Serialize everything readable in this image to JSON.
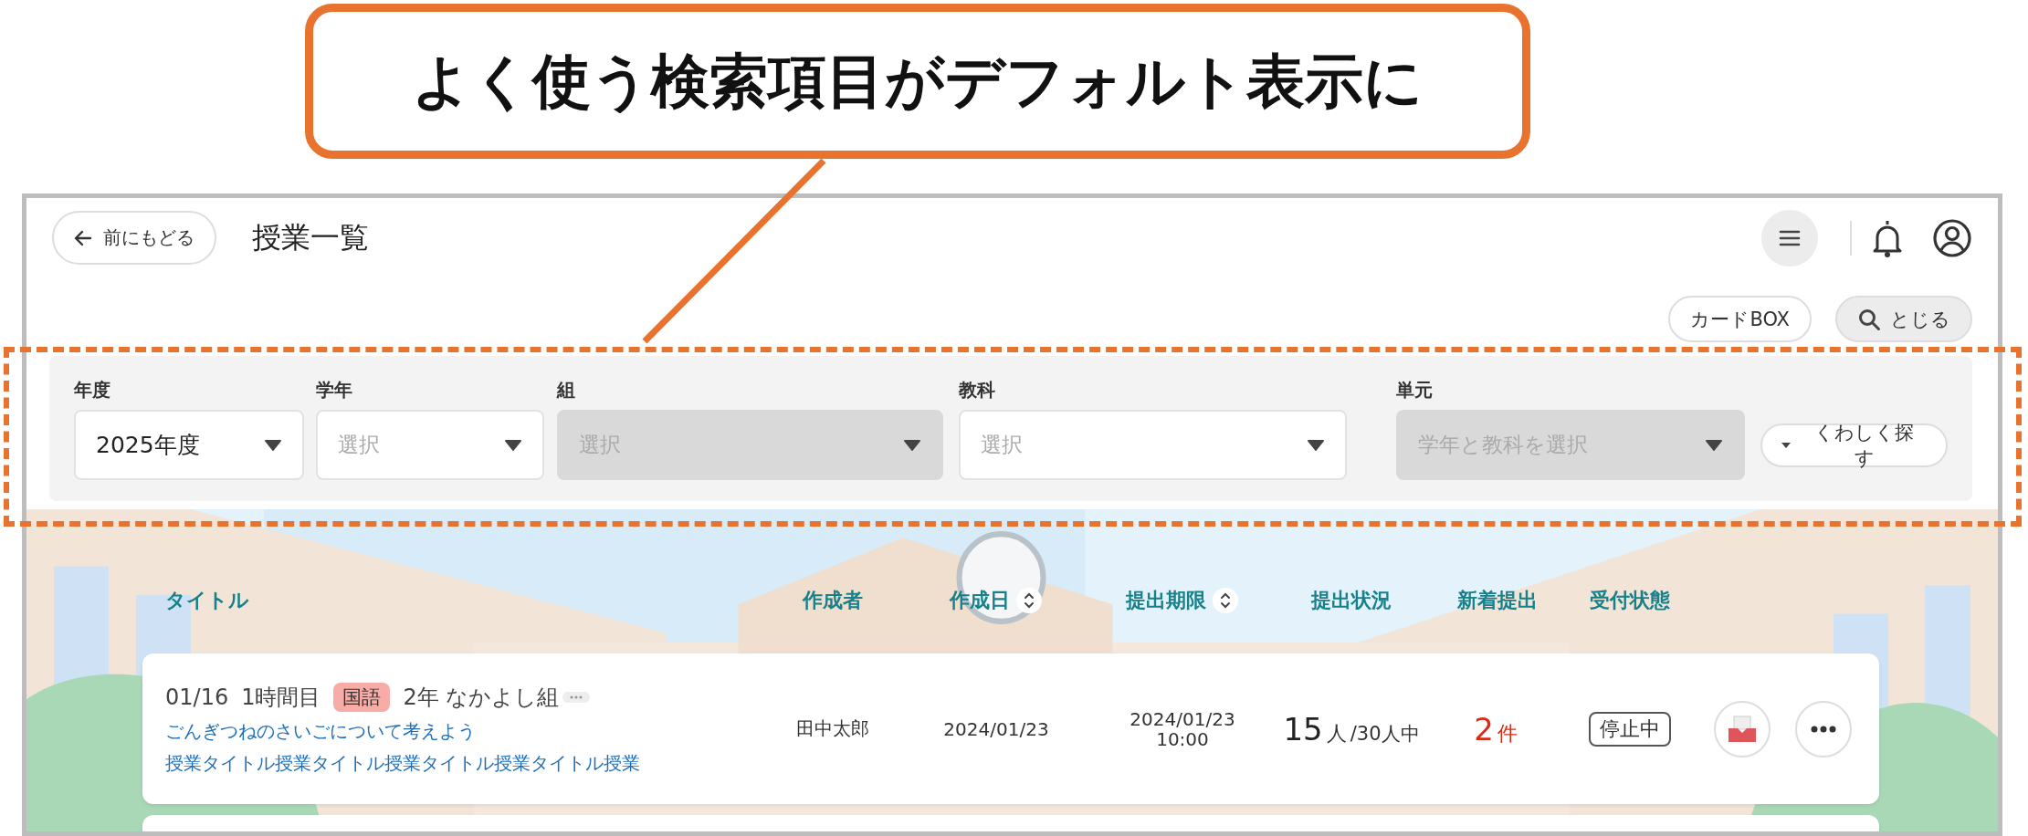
{
  "callout": {
    "text": "よく使う検索項目がデフォルト表示に"
  },
  "header": {
    "back_button": "前にもどる",
    "title": "授業一覧"
  },
  "toolbar": [
    {
      "label": "カードBOX",
      "kind": "plain"
    },
    {
      "label": "とじる",
      "kind": "search"
    }
  ],
  "filters": [
    {
      "label": "年度",
      "value": "2025年度",
      "disabled": false
    },
    {
      "label": "学年",
      "placeholder": "選択",
      "disabled": false
    },
    {
      "label": "組",
      "placeholder": "選択",
      "disabled": true
    },
    {
      "label": "教科",
      "placeholder": "選択",
      "disabled": false
    },
    {
      "label": "単元",
      "placeholder": "学年と教科を選択",
      "disabled": true
    }
  ],
  "detail_search_button": "くわしく探す",
  "table": {
    "columns": [
      {
        "label": "タイトル",
        "sortable": false
      },
      {
        "label": "作成者",
        "sortable": false
      },
      {
        "label": "作成日",
        "sortable": true
      },
      {
        "label": "提出期限",
        "sortable": true
      },
      {
        "label": "提出状況",
        "sortable": false
      },
      {
        "label": "新着提出",
        "sortable": false
      },
      {
        "label": "受付状態",
        "sortable": false
      }
    ],
    "rows": [
      {
        "date": "01/16",
        "period": "1時間目",
        "subject": "国語",
        "class": "2年 なかよし組",
        "title": "ごんぎつねのさいごについて考えよう",
        "lesson_title": "授業タイトル授業タイトル授業タイトル授業タイトル授業",
        "author": "田中太郎",
        "created": "2024/01/23",
        "deadline_date": "2024/01/23",
        "deadline_time": "10:00",
        "submitted": "15",
        "submitted_unit": "人",
        "total": "/30人中",
        "new_count": "2",
        "new_unit": "件",
        "status": "停止中"
      }
    ]
  }
}
